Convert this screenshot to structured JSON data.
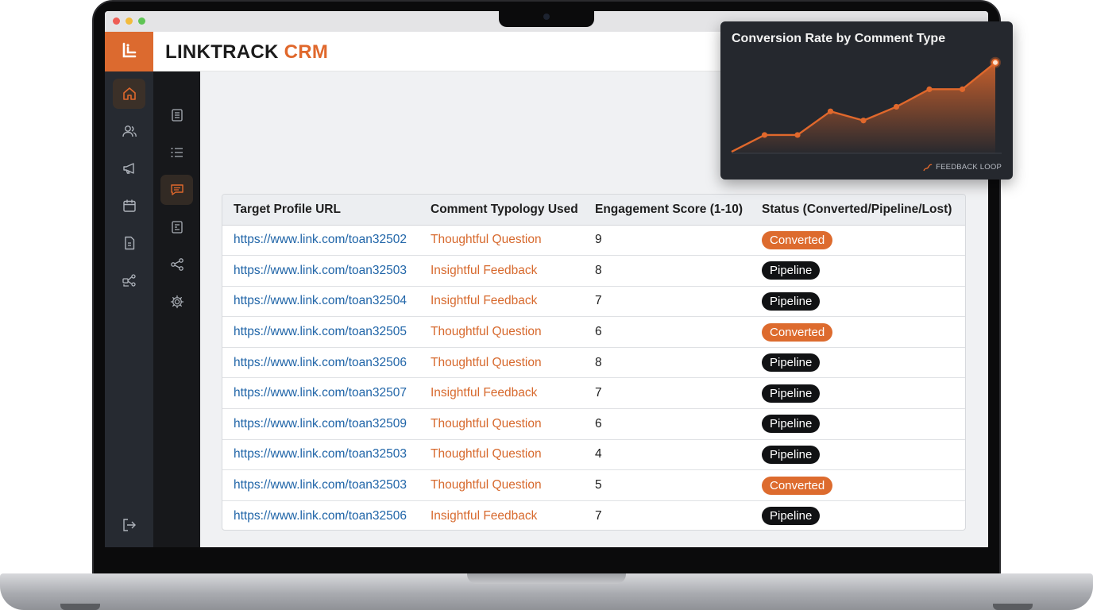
{
  "app": {
    "name_main": "LINKTRACK ",
    "name_accent": "CRM"
  },
  "rail": {
    "items": [
      {
        "icon": "home-icon",
        "active": true
      },
      {
        "icon": "users-icon",
        "active": false
      },
      {
        "icon": "megaphone-icon",
        "active": false
      },
      {
        "icon": "calendar-icon",
        "active": false
      },
      {
        "icon": "document-icon",
        "active": false
      },
      {
        "icon": "network-icon",
        "active": false
      }
    ],
    "logout_icon": "logout-icon"
  },
  "subrail": {
    "items": [
      {
        "icon": "notes-icon",
        "active": false
      },
      {
        "icon": "list-icon",
        "active": false
      },
      {
        "icon": "comment-icon",
        "active": true
      },
      {
        "icon": "report-icon",
        "active": false
      },
      {
        "icon": "share-icon",
        "active": false
      },
      {
        "icon": "settings-icon",
        "active": false
      }
    ]
  },
  "table": {
    "headers": [
      "Target Profile URL",
      "Comment Typology Used",
      "Engagement Score (1-10)",
      "Status (Converted/Pipeline/Lost)"
    ],
    "rows": [
      {
        "url": "https://www.link.com/toan32502",
        "typology": "Thoughtful Question",
        "score": "9",
        "status": "Converted"
      },
      {
        "url": "https://www.link.com/toan32503",
        "typology": "Insightful Feedback",
        "score": "8",
        "status": "Pipeline"
      },
      {
        "url": "https://www.link.com/toan32504",
        "typology": "Insightful Feedback",
        "score": "7",
        "status": "Pipeline"
      },
      {
        "url": "https://www.link.com/toan32505",
        "typology": "Thoughtful Question",
        "score": "6",
        "status": "Converted"
      },
      {
        "url": "https://www.link.com/toan32506",
        "typology": "Thoughtful Question",
        "score": "8",
        "status": "Pipeline"
      },
      {
        "url": "https://www.link.com/toan32507",
        "typology": "Insightful Feedback",
        "score": "7",
        "status": "Pipeline"
      },
      {
        "url": "https://www.link.com/toan32509",
        "typology": "Thoughtful Question",
        "score": "6",
        "status": "Pipeline"
      },
      {
        "url": "https://www.link.com/toan32503",
        "typology": "Thoughtful Question",
        "score": "4",
        "status": "Pipeline"
      },
      {
        "url": "https://www.link.com/toan32503",
        "typology": "Thoughtful Question",
        "score": "5",
        "status": "Converted"
      },
      {
        "url": "https://www.link.com/toan32506",
        "typology": "Insightful Feedback",
        "score": "7",
        "status": "Pipeline"
      }
    ]
  },
  "colors": {
    "accent": "#e0682c",
    "link": "#2065a8",
    "pipeline": "#111214",
    "converted": "#dd6b2e"
  },
  "chart_data": {
    "type": "line",
    "title": "Conversion Rate by Comment Type",
    "footer": "FEEDBACK LOOP",
    "x": [
      0,
      1,
      2,
      3,
      4,
      5,
      6,
      7,
      8
    ],
    "series": [
      {
        "values": [
          2,
          24,
          24,
          55,
          43,
          61,
          84,
          84,
          119
        ]
      }
    ],
    "ylim": [
      0,
      125
    ],
    "grid": false,
    "fill": "area gradient",
    "highlight_last_point": true
  }
}
